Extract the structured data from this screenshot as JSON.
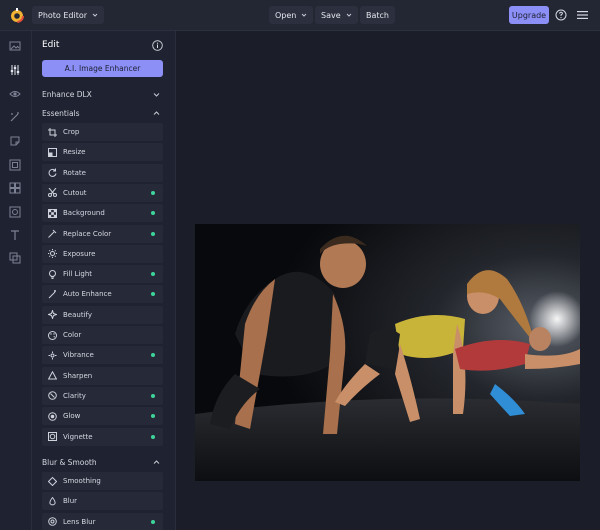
{
  "topbar": {
    "app_name": "Photo Editor",
    "open_label": "Open",
    "save_label": "Save",
    "batch_label": "Batch",
    "upgrade_label": "Upgrade"
  },
  "rail": {
    "icons": [
      "image-icon",
      "sliders-icon",
      "eye-icon",
      "magic-wand-icon",
      "sticker-icon",
      "frame-icon",
      "collage-icon",
      "overlay-icon",
      "text-icon",
      "layers-icon"
    ]
  },
  "panel": {
    "title": "Edit",
    "ai_button": "A.I. Image Enhancer",
    "enhance_section": "Enhance DLX",
    "essentials_section": "Essentials",
    "essentials": [
      {
        "label": "Crop",
        "icon": "crop-icon",
        "premium": false
      },
      {
        "label": "Resize",
        "icon": "resize-icon",
        "premium": false
      },
      {
        "label": "Rotate",
        "icon": "rotate-icon",
        "premium": false
      },
      {
        "label": "Cutout",
        "icon": "scissors-icon",
        "premium": true
      },
      {
        "label": "Background",
        "icon": "checker-icon",
        "premium": true
      },
      {
        "label": "Replace Color",
        "icon": "dropper-icon",
        "premium": true
      },
      {
        "label": "Exposure",
        "icon": "sun-icon",
        "premium": false
      },
      {
        "label": "Fill Light",
        "icon": "bulb-icon",
        "premium": true
      },
      {
        "label": "Auto Enhance",
        "icon": "wand-icon",
        "premium": true
      },
      {
        "label": "Beautify",
        "icon": "sparkle-icon",
        "premium": false
      },
      {
        "label": "Color",
        "icon": "palette-icon",
        "premium": false
      },
      {
        "label": "Vibrance",
        "icon": "vibrance-icon",
        "premium": true
      },
      {
        "label": "Sharpen",
        "icon": "triangle-icon",
        "premium": false
      },
      {
        "label": "Clarity",
        "icon": "clarity-icon",
        "premium": true
      },
      {
        "label": "Glow",
        "icon": "glow-icon",
        "premium": true
      },
      {
        "label": "Vignette",
        "icon": "vignette-icon",
        "premium": true
      }
    ],
    "blur_section": "Blur & Smooth",
    "blur": [
      {
        "label": "Smoothing",
        "icon": "diamond-icon",
        "premium": false
      },
      {
        "label": "Blur",
        "icon": "drop-icon",
        "premium": false
      },
      {
        "label": "Lens Blur",
        "icon": "lens-icon",
        "premium": true
      }
    ]
  },
  "colors": {
    "accent": "#8b8ff6",
    "premium_dot": "#3fd39a",
    "background": "#1b1d28",
    "panel": "#1f2230"
  }
}
